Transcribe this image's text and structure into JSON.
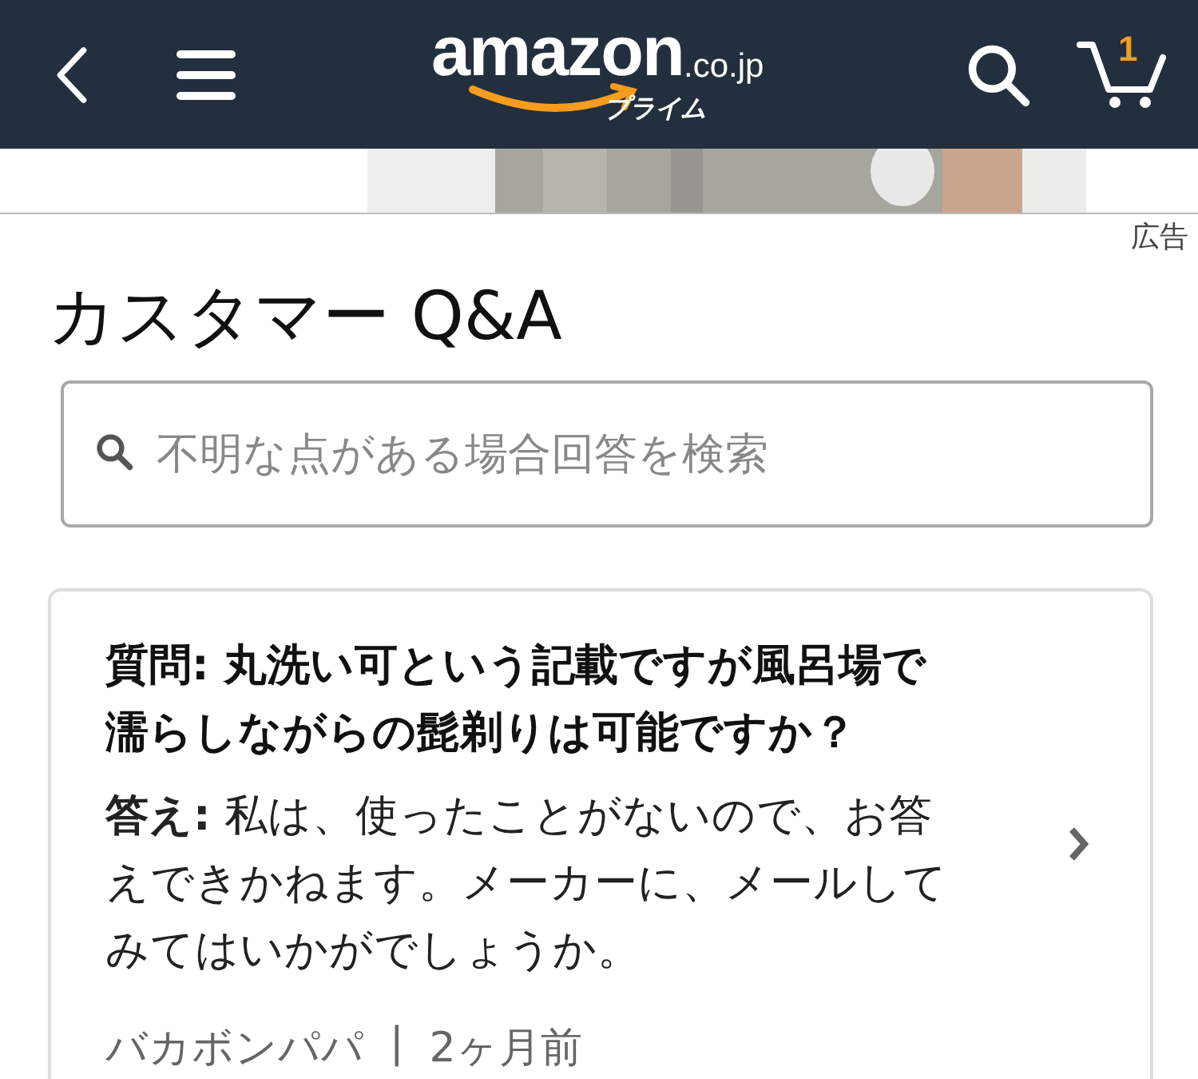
{
  "header": {
    "logo": {
      "wordmark": "amazon",
      "domain": ".co.jp",
      "tagline": "プライム"
    },
    "cart_count": "1"
  },
  "ad": {
    "label": "広告"
  },
  "title": "カスタマー Q&A",
  "search": {
    "placeholder": "不明な点がある場合回答を検索"
  },
  "questions": [
    {
      "question": "質問: 丸洗い可という記載ですが風呂場で濡らしながらの髭剃りは可能ですか？",
      "answer": "**答え:** 私は、使ったことがないので、お答えできかねます。メーカーに、メールしてみてはいかがでしょうか。",
      "author": "バカボンパパ",
      "separator": "|",
      "time": "2ヶ月前"
    }
  ]
}
